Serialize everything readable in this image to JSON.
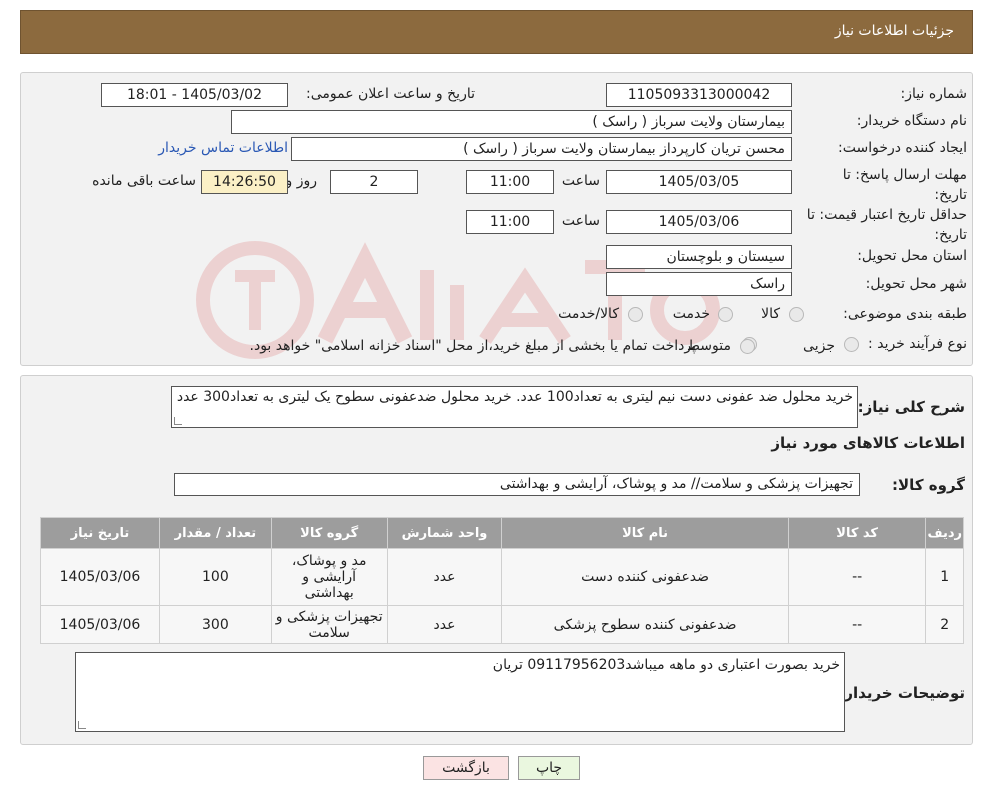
{
  "header": {
    "title": "جزئیات اطلاعات نیاز"
  },
  "form": {
    "need_number": {
      "label": "شماره نیاز:",
      "value": "1105093313000042"
    },
    "announce_datetime": {
      "label": "تاریخ و ساعت اعلان عمومی:",
      "value": "1405/03/02 - 18:01"
    },
    "buyer_org": {
      "label": "نام دستگاه خریدار:",
      "value": "بیمارستان ولایت سرباز ( راسک )"
    },
    "requester": {
      "label": "ایجاد کننده درخواست:",
      "value": "محسن تریان کارپرداز بیمارستان ولایت سرباز ( راسک )",
      "contact_link": "اطلاعات تماس خریدار"
    },
    "reply_deadline": {
      "label": "مهلت ارسال پاسخ: تا تاریخ:",
      "date": "1405/03/05",
      "time_label": "ساعت",
      "time": "11:00",
      "days": "2",
      "days_label": "روز و",
      "remaining": "14:26:50",
      "remaining_label": "ساعت باقی مانده"
    },
    "price_validity": {
      "label": "حداقل تاریخ اعتبار قیمت: تا تاریخ:",
      "date": "1405/03/06",
      "time_label": "ساعت",
      "time": "11:00"
    },
    "delivery_province": {
      "label": "استان محل تحویل:",
      "value": "سیستان و بلوچستان"
    },
    "delivery_city": {
      "label": "شهر محل تحویل:",
      "value": "راسک"
    },
    "category": {
      "label": "طبقه بندی موضوعی:",
      "options": [
        "کالا",
        "خدمت",
        "کالا/خدمت"
      ]
    },
    "purchase_type": {
      "label": "نوع فرآیند خرید :",
      "options": [
        "جزیی",
        "متوسط"
      ],
      "note": "پرداخت تمام یا بخشی از مبلغ خرید،از محل \"اسناد خزانه اسلامی\" خواهد بود."
    }
  },
  "details": {
    "summary_label": "شرح کلی نیاز:",
    "summary_text": "خرید محلول ضد عفونی دست نیم لیتری به تعداد100 عدد. خرید محلول ضدعفونی سطوح یک لیتری به تعداد300 عدد",
    "items_title": "اطلاعات کالاهای مورد نیاز",
    "group_label": "گروه کالا:",
    "group_value": "تجهیزات پزشکی و سلامت// مد و پوشاک، آرایشی و بهداشتی",
    "table": {
      "headers": [
        "ردیف",
        "کد کالا",
        "نام کالا",
        "واحد شمارش",
        "گروه کالا",
        "تعداد / مقدار",
        "تاریخ نیاز"
      ],
      "rows": [
        [
          "1",
          "--",
          "ضدعفونی کننده دست",
          "عدد",
          "مد و پوشاک، آرایشی و بهداشتی",
          "100",
          "1405/03/06"
        ],
        [
          "2",
          "--",
          "ضدعفونی کننده سطوح پزشکی",
          "عدد",
          "تجهیزات پزشکی و سلامت",
          "300",
          "1405/03/06"
        ]
      ]
    },
    "buyer_notes_label": "توضیحات خریدار:",
    "buyer_notes": "خرید بصورت اعتباری دو ماهه میباشد09117956203 تریان"
  },
  "buttons": {
    "print": "چاپ",
    "back": "بازگشت"
  },
  "colors": {
    "header_bg": "#8c6a3e",
    "link": "#2a58b4",
    "timer_bg": "#fbf0c6",
    "print_bg": "#eaf7df",
    "back_bg": "#fbe3e3"
  }
}
